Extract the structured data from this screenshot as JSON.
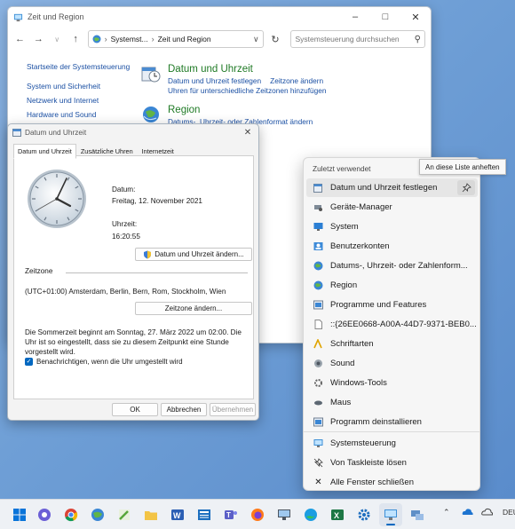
{
  "control_panel": {
    "title": "Zeit und Region",
    "address_part1": "Systemst...",
    "address_part2": "Zeit und Region",
    "search_placeholder": "Systemsteuerung durchsuchen",
    "left_nav": {
      "home": "Startseite der Systemsteuerung",
      "items": [
        "System und Sicherheit",
        "Netzwerk und Internet",
        "Hardware und Sound"
      ]
    },
    "categories": [
      {
        "title": "Datum und Uhrzeit",
        "links": [
          "Datum und Uhrzeit festlegen",
          "Zeitzone ändern",
          "Uhren für unterschiedliche Zeitzonen hinzufügen"
        ]
      },
      {
        "title": "Region",
        "links": [
          "Datums-, Uhrzeit- oder Zahlenformat ändern"
        ]
      }
    ]
  },
  "dialog": {
    "title": "Datum und Uhrzeit",
    "tabs": [
      "Datum und Uhrzeit",
      "Zusätzliche Uhren",
      "Internetzeit"
    ],
    "date_label": "Datum:",
    "date_value": "Freitag, 12. November 2021",
    "time_label": "Uhrzeit:",
    "time_value": "16:20:55",
    "change_datetime_button": "Datum und Uhrzeit ändern...",
    "timezone_section": "Zeitzone",
    "timezone_value": "(UTC+01:00) Amsterdam, Berlin, Bern, Rom, Stockholm, Wien",
    "change_timezone_button": "Zeitzone ändern...",
    "dst_info": "Die Sommerzeit beginnt am Sonntag, 27. März 2022 um 02:00. Die Uhr ist so eingestellt, dass sie zu diesem Zeitpunkt eine Stunde vorgestellt wird.",
    "notify_checkbox": "Benachrichtigen, wenn die Uhr umgestellt wird",
    "notify_checked": true,
    "ok_button": "OK",
    "cancel_button": "Abbrechen",
    "apply_button": "Übernehmen"
  },
  "jumplist": {
    "header": "Zuletzt verwendet",
    "tooltip": "An diese Liste anheften",
    "recent": [
      {
        "label": "Datum und Uhrzeit festlegen",
        "icon": "datetime-icon"
      },
      {
        "label": "Geräte-Manager",
        "icon": "device-manager-icon"
      },
      {
        "label": "System",
        "icon": "system-icon"
      },
      {
        "label": "Benutzerkonten",
        "icon": "user-accounts-icon"
      },
      {
        "label": "Datums-, Uhrzeit- oder Zahlenform...",
        "icon": "region-format-icon"
      },
      {
        "label": "Region",
        "icon": "region-icon"
      },
      {
        "label": "Programme und Features",
        "icon": "programs-icon"
      },
      {
        "label": "::{26EE0668-A00A-44D7-9371-BEB0...",
        "icon": "file-icon"
      },
      {
        "label": "Schriftarten",
        "icon": "fonts-icon"
      },
      {
        "label": "Sound",
        "icon": "sound-icon"
      },
      {
        "label": "Windows-Tools",
        "icon": "tools-icon"
      },
      {
        "label": "Maus",
        "icon": "mouse-icon"
      },
      {
        "label": "Programm deinstallieren",
        "icon": "uninstall-icon"
      }
    ],
    "tasks": [
      {
        "label": "Systemsteuerung",
        "icon": "control-panel-icon"
      },
      {
        "label": "Von Taskleiste lösen",
        "icon": "unpin-icon"
      },
      {
        "label": "Alle Fenster schließen",
        "icon": "close-icon"
      }
    ]
  },
  "taskbar": {
    "language": "DEU",
    "apps": [
      "start-icon",
      "chat-icon",
      "chrome-icon",
      "globe-icon",
      "paint-icon",
      "explorer-icon",
      "word-icon",
      "news-icon",
      "teams-icon",
      "firefox-icon",
      "rdp-icon",
      "edge-icon",
      "excel-icon",
      "settings-icon",
      "control-panel-icon",
      "network-icon"
    ]
  }
}
